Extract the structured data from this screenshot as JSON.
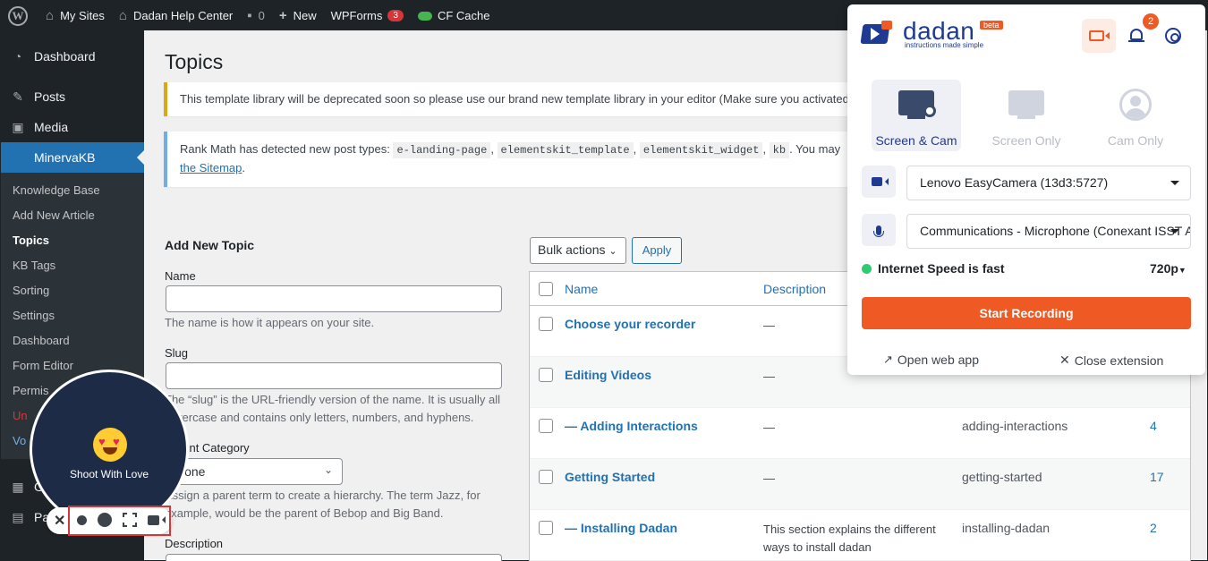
{
  "adminbar": {
    "items": [
      {
        "label": "My Sites"
      },
      {
        "label": "Dadan Help Center"
      },
      {
        "label": "0"
      },
      {
        "label": "New"
      },
      {
        "label": "WPForms"
      },
      {
        "label": "CF Cache"
      }
    ],
    "wpforms_count": "3"
  },
  "sidebar": {
    "items": [
      "Dashboard",
      "Posts",
      "Media",
      "MinervaKB"
    ],
    "submenu": [
      "Knowledge Base",
      "Add New Article",
      "Topics",
      "KB Tags",
      "Sorting",
      "Settings",
      "Dashboard",
      "Form Editor",
      "Permis",
      "Un",
      "Vo"
    ],
    "more": [
      "G",
      "Pages"
    ]
  },
  "main": {
    "title": "Topics",
    "notice1": "This template library will be deprecated soon so please use our brand new template library in your editor (Make sure you activated",
    "notice2_prefix": "Rank Math has detected new post types:",
    "notice2_codes": [
      "e-landing-page",
      "elementskit_template",
      "elementskit_widget",
      "kb"
    ],
    "notice2_suffix": ". You may",
    "notice2_link": "the Sitemap",
    "form": {
      "title": "Add New Topic",
      "name_label": "Name",
      "name_desc": "The name is how it appears on your site.",
      "slug_label": "Slug",
      "slug_desc": "The “slug” is the URL-friendly version of the name. It is usually all lowercase and contains only letters, numbers, and hyphens.",
      "parent_label": "Parent Category",
      "parent_value": "None",
      "parent_desc": "Assign a parent term to create a hierarchy. The term Jazz, for example, would be the parent of Bebop and Big Band.",
      "description_label": "Description"
    },
    "bulk_actions": "Bulk actions",
    "apply": "Apply",
    "table": {
      "headers": [
        "Name",
        "Description"
      ],
      "rows": [
        {
          "name": "Choose your recorder",
          "desc": "—",
          "slug": "",
          "count": ""
        },
        {
          "name": "Editing Videos",
          "desc": "—",
          "slug": "",
          "count": ""
        },
        {
          "name": "— Adding Interactions",
          "desc": "—",
          "slug": "adding-interactions",
          "count": "4"
        },
        {
          "name": "Getting Started",
          "desc": "—",
          "slug": "getting-started",
          "count": "17"
        },
        {
          "name": "— Installing Dadan",
          "desc": "This section explains the different ways to install dadan",
          "slug": "installing-dadan",
          "count": "2"
        }
      ]
    }
  },
  "extension": {
    "brand": "dadan",
    "beta": "beta",
    "tagline": "instructions made simple",
    "notification_count": "2",
    "modes": [
      {
        "label": "Screen & Cam",
        "active": true
      },
      {
        "label": "Screen Only",
        "active": false
      },
      {
        "label": "Cam Only",
        "active": false
      }
    ],
    "camera": "Lenovo EasyCamera (13d3:5727)",
    "microphone": "Communications - Microphone (Conexant ISST Audio)",
    "speed_text": "Internet Speed is fast",
    "resolution": "720p",
    "start_button": "Start Recording",
    "open_web_app": "Open web app",
    "close_extension": "Close extension",
    "accent_color": "#ef5a24",
    "brand_color": "#1f3a93"
  },
  "floating": {
    "label": "Shoot With Love",
    "close": "✕"
  }
}
